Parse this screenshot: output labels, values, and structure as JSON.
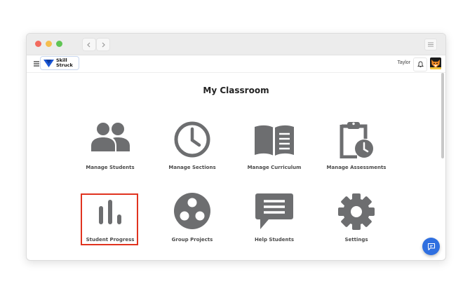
{
  "window": {
    "traffic_lights": [
      "close",
      "minimize",
      "zoom"
    ],
    "nav": {
      "back_icon": "chevron-left-icon",
      "forward_icon": "chevron-right-icon"
    },
    "menu_icon": "lines-icon"
  },
  "appbar": {
    "menu_icon": "hamburger-icon",
    "logo": {
      "line1": "Skill",
      "line2": "Struck"
    },
    "user_name": "Taylor",
    "notification_icon": "bell-icon",
    "avatar_icon": "fox-avatar-icon"
  },
  "page": {
    "title": "My Classroom",
    "tiles": [
      {
        "label": "Manage Students",
        "icon": "people-icon"
      },
      {
        "label": "Manage Sections",
        "icon": "clock-icon"
      },
      {
        "label": "Manage Curriculum",
        "icon": "open-book-icon"
      },
      {
        "label": "Manage Assessments",
        "icon": "clipboard-clock-icon"
      },
      {
        "label": "Student Progress",
        "icon": "bar-chart-icon"
      },
      {
        "label": "Group Projects",
        "icon": "group-circles-icon"
      },
      {
        "label": "Help Students",
        "icon": "chat-bubble-icon"
      },
      {
        "label": "Settings",
        "icon": "gear-icon"
      }
    ],
    "highlighted_tile": "Student Progress"
  },
  "chat_button": {
    "icon": "chat-icon"
  },
  "colors": {
    "icon_gray": "#6d6e70",
    "accent_blue": "#2f6fe0",
    "highlight_red": "#e0331f"
  }
}
